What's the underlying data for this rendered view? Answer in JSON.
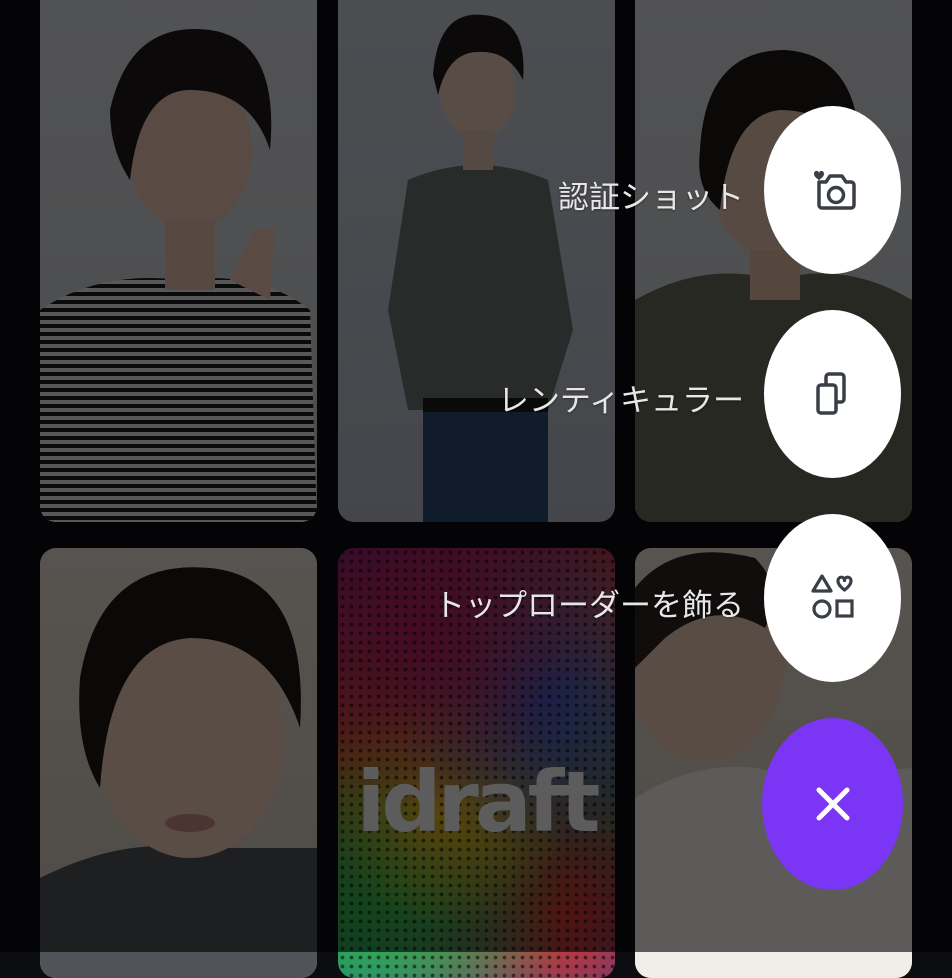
{
  "gallery": {
    "cards": [
      {
        "kind": "photo",
        "shirt": "striped"
      },
      {
        "kind": "photo",
        "shirt": "grey"
      },
      {
        "kind": "photo",
        "shirt": "olive"
      },
      {
        "kind": "photo",
        "shirt": "grey"
      },
      {
        "kind": "logo",
        "text": "idraft"
      },
      {
        "kind": "photo",
        "shirt": "white"
      }
    ]
  },
  "fab_menu": {
    "items": [
      {
        "label": "認証ショット",
        "icon": "camera-heart-icon"
      },
      {
        "label": "レンティキュラー",
        "icon": "lenticular-cards-icon"
      },
      {
        "label": "トップローダーを飾る",
        "icon": "shapes-icon"
      }
    ],
    "close_icon": "close-icon",
    "accent_color": "#7b35f5"
  }
}
